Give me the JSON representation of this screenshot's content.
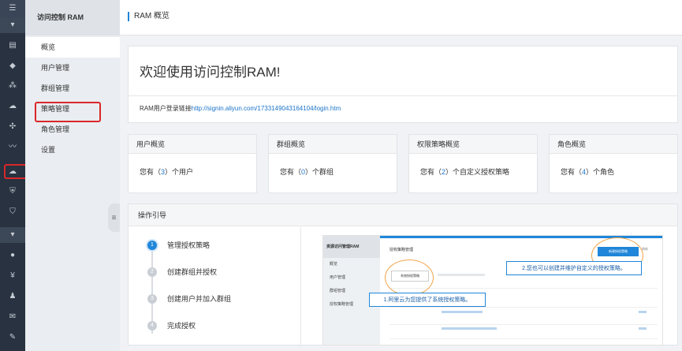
{
  "header": {
    "title": "RAM 概览"
  },
  "menu": {
    "title": "访问控制 RAM",
    "items": [
      {
        "label": "概览"
      },
      {
        "label": "用户管理"
      },
      {
        "label": "群组管理"
      },
      {
        "label": "策略管理"
      },
      {
        "label": "角色管理"
      },
      {
        "label": "设置"
      }
    ]
  },
  "welcome": {
    "title": "欢迎使用访问控制RAM!",
    "login_prefix": "RAM用户登录链接",
    "login_url": "http://signin.aliyun.com/1733149043164104/login.htm"
  },
  "cards": [
    {
      "title": "用户概览",
      "prefix": "您有（",
      "count": "3",
      "suffix": "）个用户"
    },
    {
      "title": "群组概览",
      "prefix": "您有（",
      "count": "0",
      "suffix": "）个群组"
    },
    {
      "title": "权限策略概览",
      "prefix": "您有（",
      "count": "2",
      "suffix": "）个自定义授权策略"
    },
    {
      "title": "角色概览",
      "prefix": "您有（",
      "count": "4",
      "suffix": "）个角色"
    }
  ],
  "guide": {
    "title": "操作引导",
    "steps": [
      {
        "num": "1",
        "label": "管理授权策略"
      },
      {
        "num": "2",
        "label": "创建群组并授权"
      },
      {
        "num": "3",
        "label": "创建用户并加入群组"
      },
      {
        "num": "4",
        "label": "完成授权"
      }
    ],
    "preview": {
      "side_title": "资源访问管理RAM",
      "side_items": [
        "概览",
        "用户管理",
        "群组管理",
        "授权策略管理"
      ],
      "head": "授权策略管理",
      "tab": "系统授权策略",
      "button": "新建授权策略",
      "button2": "刷新",
      "callout1": "1.阿里云为您提供了系统授权策略。",
      "callout2": "2.您也可以创建并维护自定义的授权策略。"
    }
  },
  "rail_icons": [
    "menu-icon",
    "caret-down-icon",
    "list-icon",
    "diamond-icon",
    "nodes-icon",
    "cloud-gear-icon",
    "share-icon",
    "wave-icon",
    "cloud-icon",
    "shield-icon",
    "shield-check-icon",
    "caret-down-icon",
    "user-icon",
    "yen-icon",
    "people-icon",
    "mail-icon",
    "pencil-icon"
  ]
}
